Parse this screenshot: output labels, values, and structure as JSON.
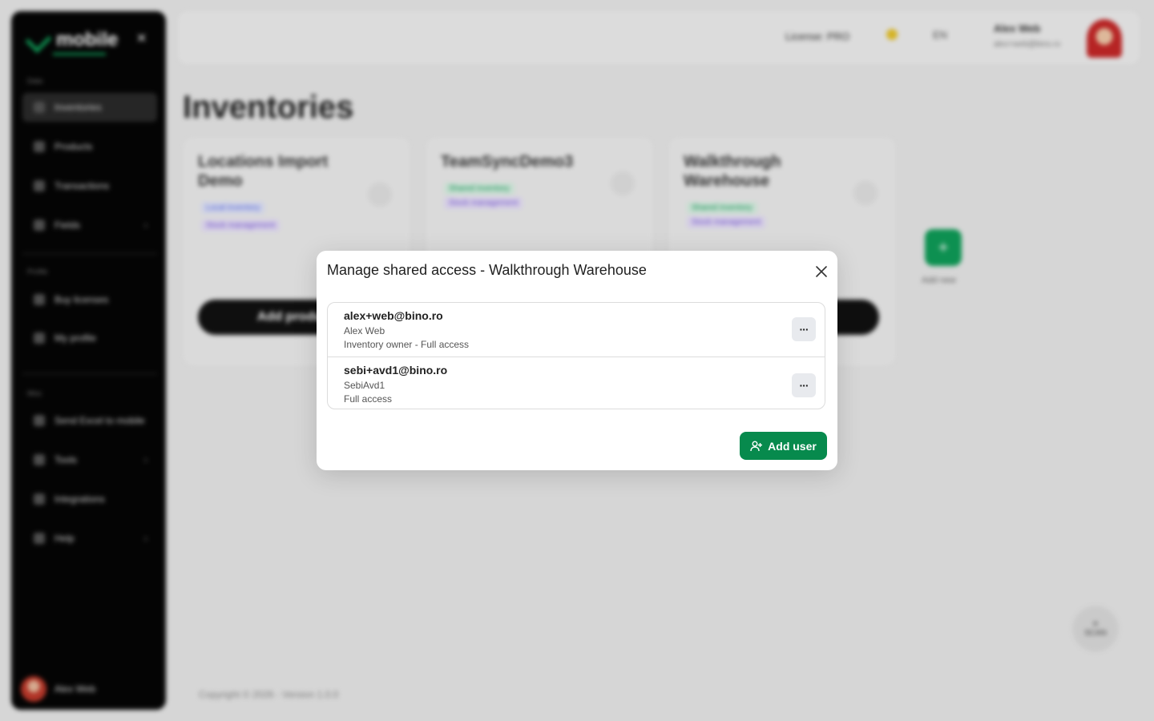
{
  "app": {
    "logo_text": "mobile",
    "sidebar": {
      "section_1": "Data",
      "section_2": "Profile",
      "section_3": "Misc",
      "items": [
        {
          "label": "Inventories"
        },
        {
          "label": "Products"
        },
        {
          "label": "Transactions"
        },
        {
          "label": "Fields"
        },
        {
          "label": "Buy licenses"
        },
        {
          "label": "My profile"
        },
        {
          "label": "Send Excel to mobile"
        },
        {
          "label": "Tools"
        },
        {
          "label": "Integrations"
        },
        {
          "label": "Help"
        }
      ],
      "user_name": "Alex Web"
    },
    "topbar": {
      "license": "License: PRO",
      "language": "EN",
      "user_name": "Alex Web",
      "user_email": "alex+web@bino.ro"
    },
    "page_title": "Inventories",
    "cards": [
      {
        "name": "Locations Import Demo",
        "tag": "Local inventory",
        "tag2": "Stock management",
        "button": "Add products"
      },
      {
        "name": "TeamSyncDemo3",
        "tag": "Shared inventory",
        "tag2": "Stock management"
      },
      {
        "name": "Walkthrough Warehouse",
        "tag": "Shared inventory",
        "tag2": "Stock management"
      }
    ],
    "add_new_label": "Add new",
    "scan_label": "SCAN",
    "copyright": "Copyright © 2026 - Version 1.0.0"
  },
  "modal": {
    "title": "Manage shared access - Walkthrough Warehouse",
    "users": [
      {
        "email": "alex+web@bino.ro",
        "name": "Alex Web",
        "role": "Inventory owner - Full access"
      },
      {
        "email": "sebi+avd1@bino.ro",
        "name": "SebiAvd1",
        "role": "Full access"
      }
    ],
    "menu_glyph": "···",
    "add_user_label": "Add user",
    "accent_color": "#078a4d"
  }
}
